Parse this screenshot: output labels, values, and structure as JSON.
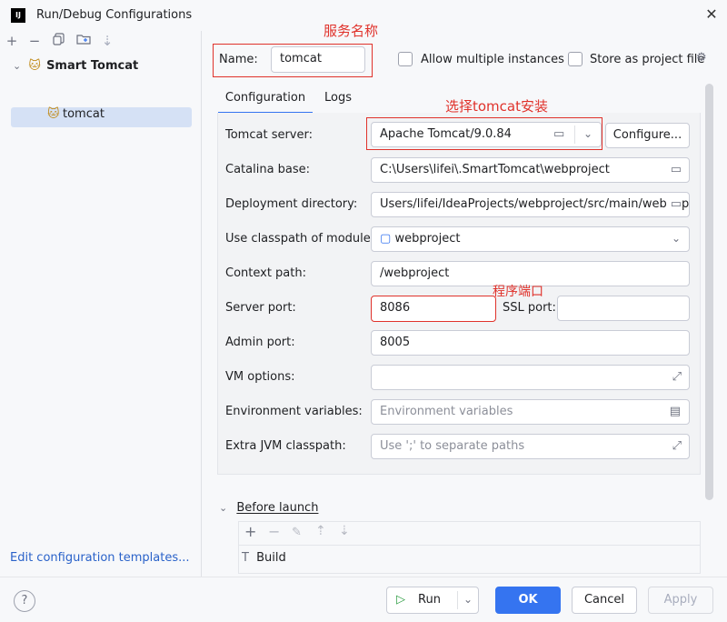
{
  "window": {
    "title": "Run/Debug Configurations",
    "app_icon": "IJ"
  },
  "sidebar": {
    "toolbar": [
      "add-icon",
      "remove-icon",
      "copy-icon",
      "new-folder-icon",
      "sort-icon"
    ],
    "group_label": "Smart Tomcat",
    "item_label": "tomcat",
    "edit_templates": "Edit configuration templates..."
  },
  "header": {
    "name_label": "Name:",
    "name_value": "tomcat",
    "allow_multiple": "Allow multiple instances",
    "store_as_file": "Store as project file"
  },
  "tabs": [
    "Configuration",
    "Logs"
  ],
  "annotations": {
    "service_name": "服务名称",
    "choose_tomcat": "选择tomcat安装",
    "program_port": "程序端口"
  },
  "form": {
    "tomcat_server_label": "Tomcat server:",
    "tomcat_server_value": "Apache Tomcat/9.0.84",
    "configure_btn": "Configure...",
    "catalina_label": "Catalina base:",
    "catalina_value": "C:\\Users\\lifei\\.SmartTomcat\\webproject",
    "deploy_label": "Deployment directory:",
    "deploy_value": "Users/lifei/IdeaProjects/webproject/src/main/webapp",
    "classpath_label": "Use classpath of module:",
    "classpath_value": "webproject",
    "context_label": "Context path:",
    "context_value": "/webproject",
    "server_port_label": "Server port:",
    "server_port_value": "8086",
    "ssl_port_label": "SSL port:",
    "ssl_port_value": "",
    "admin_port_label": "Admin port:",
    "admin_port_value": "8005",
    "vm_label": "VM options:",
    "vm_value": "",
    "env_label": "Environment variables:",
    "env_placeholder": "Environment variables",
    "jvm_label": "Extra JVM classpath:",
    "jvm_placeholder": "Use ';' to separate paths"
  },
  "before_launch": {
    "title": "Before launch",
    "task": "Build"
  },
  "footer": {
    "help": "?",
    "run": "Run",
    "ok": "OK",
    "cancel": "Cancel",
    "apply": "Apply"
  },
  "colors": {
    "accent": "#3574f0",
    "annotation": "#e0322b",
    "selection": "#d5e1f5"
  }
}
